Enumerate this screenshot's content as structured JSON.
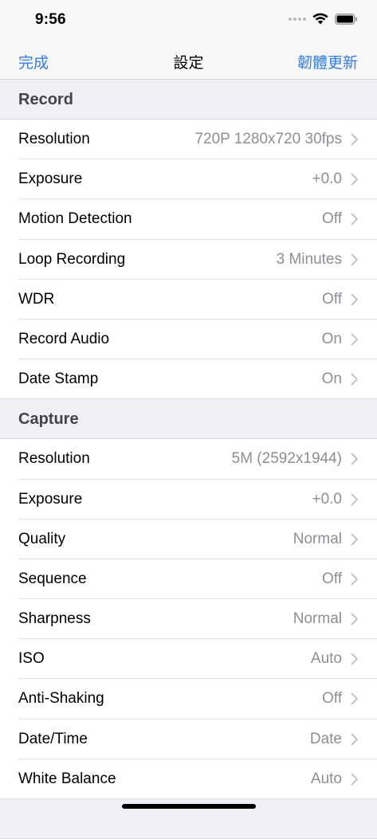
{
  "status": {
    "time": "9:56"
  },
  "nav": {
    "done_label": "完成",
    "title": "設定",
    "firmware_label": "韌體更新"
  },
  "sections": [
    {
      "title": "Record",
      "items": [
        {
          "label": "Resolution",
          "value": "720P 1280x720 30fps"
        },
        {
          "label": "Exposure",
          "value": "+0.0"
        },
        {
          "label": "Motion Detection",
          "value": "Off"
        },
        {
          "label": "Loop Recording",
          "value": "3 Minutes"
        },
        {
          "label": "WDR",
          "value": "Off"
        },
        {
          "label": "Record Audio",
          "value": "On"
        },
        {
          "label": "Date Stamp",
          "value": "On"
        }
      ]
    },
    {
      "title": "Capture",
      "items": [
        {
          "label": "Resolution",
          "value": "5M (2592x1944)"
        },
        {
          "label": "Exposure",
          "value": "+0.0"
        },
        {
          "label": "Quality",
          "value": "Normal"
        },
        {
          "label": "Sequence",
          "value": "Off"
        },
        {
          "label": "Sharpness",
          "value": "Normal"
        },
        {
          "label": "ISO",
          "value": "Auto"
        },
        {
          "label": "Anti-Shaking",
          "value": "Off"
        },
        {
          "label": "Date/Time",
          "value": "Date"
        },
        {
          "label": "White Balance",
          "value": "Auto"
        }
      ]
    },
    {
      "title": "",
      "items": []
    }
  ],
  "colors": {
    "accent": "#2f7cf6",
    "section_bg": "#efeff4",
    "value_text": "#8e8e93"
  },
  "icons": {
    "signal": "signal-dots-icon",
    "wifi": "wifi-icon",
    "battery": "battery-icon",
    "disclosure": "chevron-right-icon"
  }
}
